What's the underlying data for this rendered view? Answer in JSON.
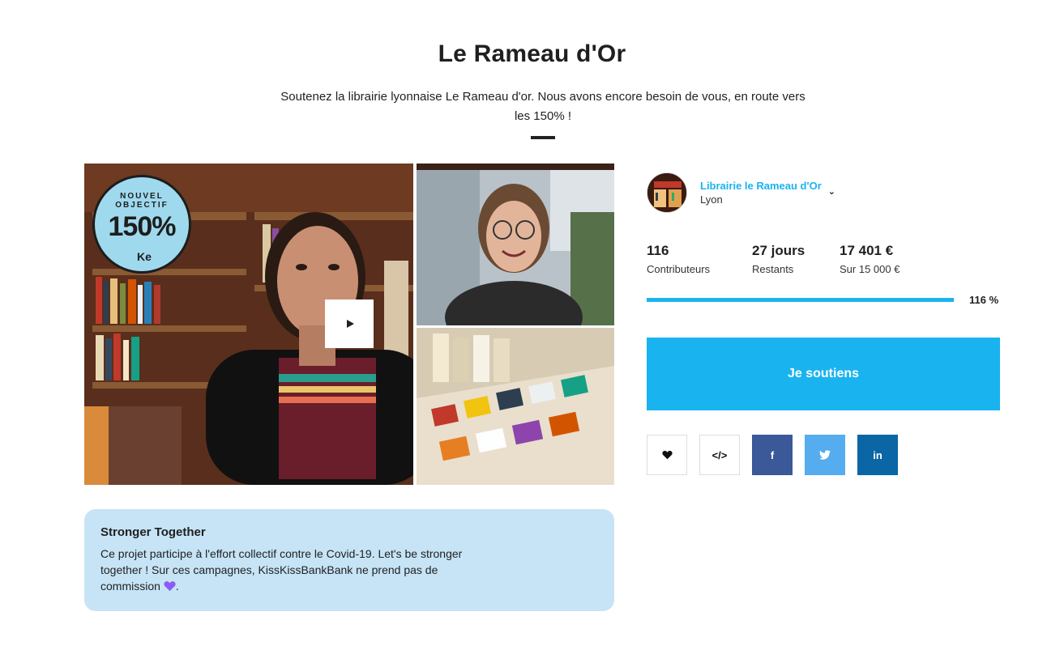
{
  "project": {
    "title": "Le Rameau d'Or",
    "subtitle": "Soutenez la librairie lyonnaise Le Rameau d'or. Nous avons encore besoin de vous, en route vers les 150% !"
  },
  "video": {
    "badge_top": "NOUVEL OBJECTIF",
    "badge_big": "150%",
    "badge_logo": "Ke"
  },
  "infobox": {
    "title": "Stronger Together",
    "text": "Ce projet participe à l'effort collectif contre le Covid-19. Let's be stronger together ! Sur ces campagnes, KissKissBankBank ne prend pas de commission",
    "suffix": "."
  },
  "owner": {
    "name": "Librairie le Rameau d'Or",
    "city": "Lyon"
  },
  "stats": {
    "contributors_value": "116",
    "contributors_label": "Contributeurs",
    "days_value": "27 jours",
    "days_label": "Restants",
    "amount_value": "17 401 €",
    "amount_label": "Sur 15 000 €"
  },
  "progress": {
    "fraction": 1.0,
    "label": "116 %"
  },
  "support_button": "Je soutiens",
  "share": {
    "embed_label": "</>",
    "facebook_label": "f",
    "linkedin_label": "in"
  },
  "colors": {
    "accent": "#19b4f0",
    "infobox_bg": "#c6e4f6",
    "facebook": "#3b5998",
    "twitter": "#55acee",
    "linkedin": "#0a66a5"
  }
}
